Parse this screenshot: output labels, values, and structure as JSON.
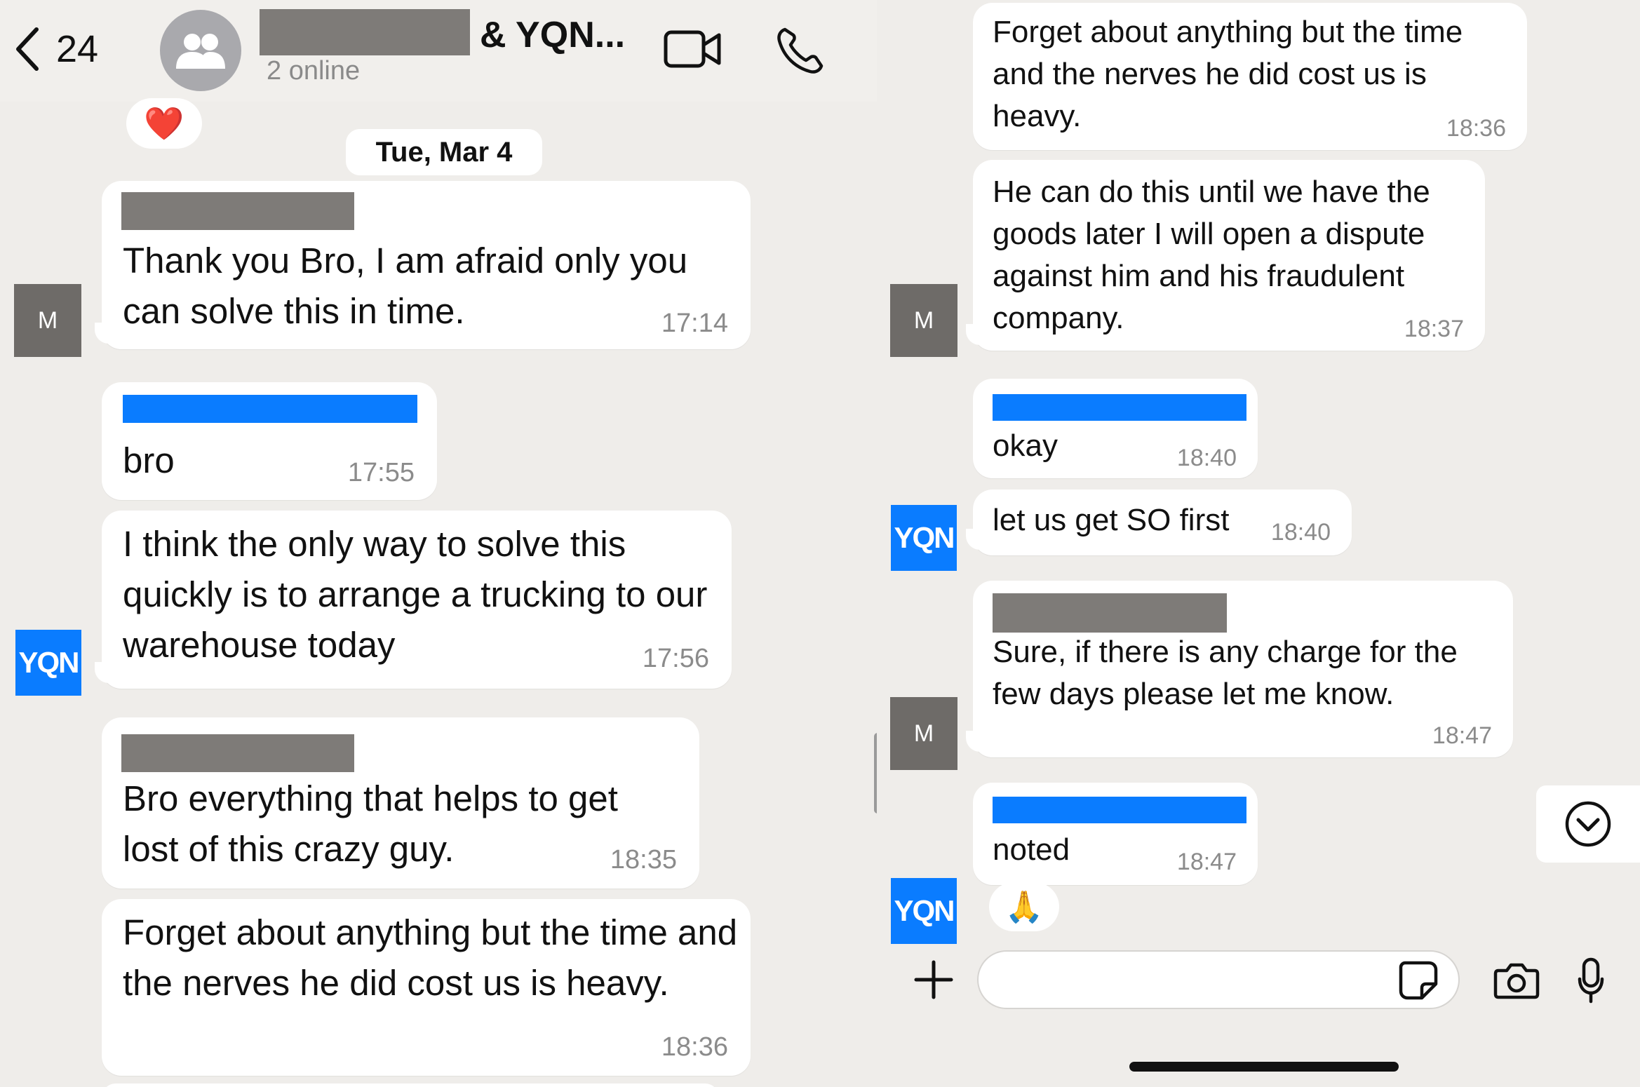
{
  "header": {
    "back_count": "24",
    "title_suffix": "& YQN...",
    "online_status": "2 online"
  },
  "date_separator": "Tue, Mar 4",
  "reactions": {
    "heart": "❤️",
    "pray": "🙏"
  },
  "left_messages": [
    {
      "text": "Thank you Bro, I am afraid only you can solve this in time.",
      "time": "17:14"
    },
    {
      "text": "bro",
      "time": "17:55"
    },
    {
      "text": "I think the only way to solve this quickly is to arrange a trucking to our warehouse today",
      "time": "17:56"
    },
    {
      "text": "Bro everything that helps to get lost of this crazy guy.",
      "time": "18:35"
    },
    {
      "text": "Forget about anything but the time and the nerves he did cost us is heavy.",
      "time": "18:36"
    }
  ],
  "right_messages": [
    {
      "text": "Forget about anything but the time and the nerves he did cost us is heavy.",
      "time": "18:36"
    },
    {
      "text": "He can do this until we have the goods later I will open a dispute against him and his fraudulent company.",
      "time": "18:37"
    },
    {
      "text": "okay",
      "time": "18:40"
    },
    {
      "text": "let us get SO first",
      "time": "18:40"
    },
    {
      "text": "Sure, if there is any charge for the few days please let me know.",
      "time": "18:47"
    },
    {
      "text": "noted",
      "time": "18:47"
    }
  ],
  "avatars": {
    "m_label": "M",
    "yqn_label": "YQN"
  },
  "icons": {
    "back": "chevron-left-icon",
    "video": "video-camera-icon",
    "phone": "phone-icon",
    "add": "plus-icon",
    "sticker": "sticker-icon",
    "camera": "camera-icon",
    "mic": "microphone-icon",
    "scroll_down": "chevron-down-circle-icon",
    "group": "group-people-icon"
  },
  "colors": {
    "background": "#efedea",
    "bubble": "#ffffff",
    "redaction_gray": "#7e7b78",
    "redaction_blue": "#0a7cff",
    "yqn_brand": "#0a7cff",
    "avatar_m": "#6e6b68"
  },
  "composer": {
    "placeholder": ""
  }
}
